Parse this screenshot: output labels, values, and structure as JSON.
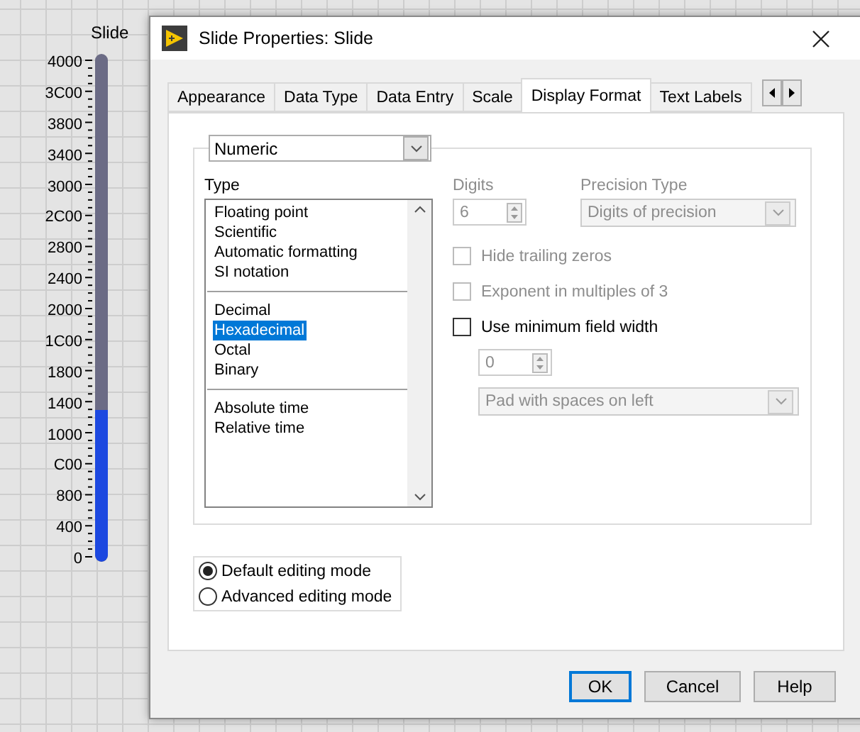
{
  "slide": {
    "label": "Slide",
    "level": 0.3,
    "scale": [
      "4000",
      "3C00",
      "3800",
      "3400",
      "3000",
      "2C00",
      "2800",
      "2400",
      "2000",
      "1C00",
      "1800",
      "1400",
      "1000",
      "C00",
      "800",
      "400",
      "0"
    ]
  },
  "dialog": {
    "title": "Slide Properties: Slide",
    "tabs": [
      {
        "label": "Appearance",
        "selected": false
      },
      {
        "label": "Data Type",
        "selected": false
      },
      {
        "label": "Data Entry",
        "selected": false
      },
      {
        "label": "Scale",
        "selected": false
      },
      {
        "label": "Display Format",
        "selected": true
      },
      {
        "label": "Text Labels",
        "selected": false
      }
    ],
    "format_dropdown": {
      "value": "Numeric"
    },
    "type_list": {
      "label": "Type",
      "groups": [
        [
          {
            "label": "Floating point",
            "selected": false
          },
          {
            "label": "Scientific",
            "selected": false
          },
          {
            "label": "Automatic formatting",
            "selected": false
          },
          {
            "label": "SI notation",
            "selected": false
          }
        ],
        [
          {
            "label": "Decimal",
            "selected": false
          },
          {
            "label": "Hexadecimal",
            "selected": true
          },
          {
            "label": "Octal",
            "selected": false
          },
          {
            "label": "Binary",
            "selected": false
          }
        ],
        [
          {
            "label": "Absolute time",
            "selected": false
          },
          {
            "label": "Relative time",
            "selected": false
          }
        ]
      ]
    },
    "digits": {
      "label": "Digits",
      "value": "6",
      "disabled": true
    },
    "precision_type": {
      "label": "Precision Type",
      "value": "Digits of precision",
      "disabled": true
    },
    "options": [
      {
        "label": "Hide trailing zeros",
        "checked": false,
        "disabled": true
      },
      {
        "label": "Exponent in multiples of 3",
        "checked": false,
        "disabled": true
      },
      {
        "label": "Use minimum field width",
        "checked": false,
        "disabled": false
      }
    ],
    "min_width": {
      "value": "0",
      "disabled": true
    },
    "padding": {
      "value": "Pad with spaces on left",
      "disabled": true
    },
    "editing_modes": [
      {
        "label": "Default editing mode",
        "selected": true
      },
      {
        "label": "Advanced editing mode",
        "selected": false
      }
    ],
    "buttons": [
      {
        "label": "OK",
        "default": true
      },
      {
        "label": "Cancel",
        "default": false
      },
      {
        "label": "Help",
        "default": false
      }
    ]
  }
}
